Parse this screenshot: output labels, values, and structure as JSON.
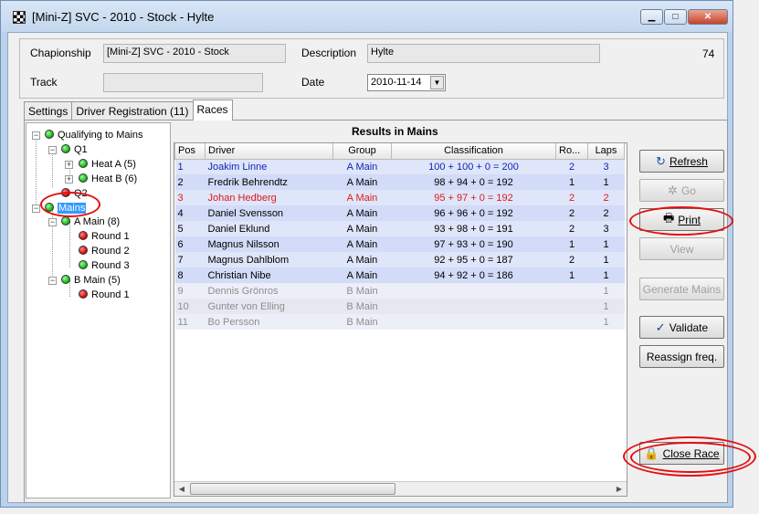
{
  "window": {
    "title": "[Mini-Z] SVC - 2010 - Stock - Hylte"
  },
  "header": {
    "championship_label": "Chapionship",
    "championship_value": "[Mini-Z] SVC - 2010 - Stock",
    "description_label": "Description",
    "description_value": "Hylte",
    "number": "74",
    "track_label": "Track",
    "track_value": "",
    "date_label": "Date",
    "date_value": "2010-11-14"
  },
  "tabs": [
    {
      "label": "Settings"
    },
    {
      "label": "Driver Registration (11)"
    },
    {
      "label": "Races"
    }
  ],
  "tree": {
    "qualifying": "Qualifying to Mains",
    "q1": "Q1",
    "heat_a": "Heat A (5)",
    "heat_b": "Heat B (6)",
    "q2": "Q2",
    "mains": "Mains",
    "a_main": "A Main (8)",
    "a_round1": "Round 1",
    "a_round2": "Round 2",
    "a_round3": "Round 3",
    "b_main": "B Main (5)",
    "b_round1": "Round 1"
  },
  "results": {
    "title": "Results in Mains",
    "columns": [
      "Pos",
      "Driver",
      "Group",
      "Classification",
      "Ro...",
      "Laps"
    ],
    "rows": [
      [
        "1",
        "Joakim Linne",
        "A Main",
        "100 + 100 + 0 = 200",
        "2",
        "3"
      ],
      [
        "2",
        "Fredrik Behrendtz",
        "A Main",
        "98 + 94 + 0 = 192",
        "1",
        "1"
      ],
      [
        "3",
        "Johan Hedberg",
        "A Main",
        "95 + 97 + 0 = 192",
        "2",
        "2"
      ],
      [
        "4",
        "Daniel Svensson",
        "A Main",
        "96 + 96 + 0 = 192",
        "2",
        "2"
      ],
      [
        "5",
        "Daniel Eklund",
        "A Main",
        "93 + 98 + 0 = 191",
        "2",
        "3"
      ],
      [
        "6",
        "Magnus Nilsson",
        "A Main",
        "97 + 93 + 0 = 190",
        "1",
        "1"
      ],
      [
        "7",
        "Magnus Dahlblom",
        "A Main",
        "92 + 95 + 0 = 187",
        "2",
        "1"
      ],
      [
        "8",
        "Christian Nibe",
        "A Main",
        "94 + 92 + 0 = 186",
        "1",
        "1"
      ],
      [
        "9",
        "Dennis Grönros",
        "B Main",
        "",
        "",
        "1"
      ],
      [
        "10",
        "Gunter von Elling",
        "B Main",
        "",
        "",
        "1"
      ],
      [
        "11",
        "Bo Persson",
        "B Main",
        "",
        "",
        "1"
      ]
    ]
  },
  "buttons": {
    "refresh": "Refresh",
    "go": "Go",
    "print": "Print",
    "view": "View",
    "generate": "Generate Mains",
    "validate": "Validate",
    "reassign": "Reassign freq.",
    "close_race": "Close Race"
  },
  "colors": {
    "highlight_blue": "#1224b4",
    "highlight_red": "#e01818",
    "annotation_red": "#e31010"
  }
}
